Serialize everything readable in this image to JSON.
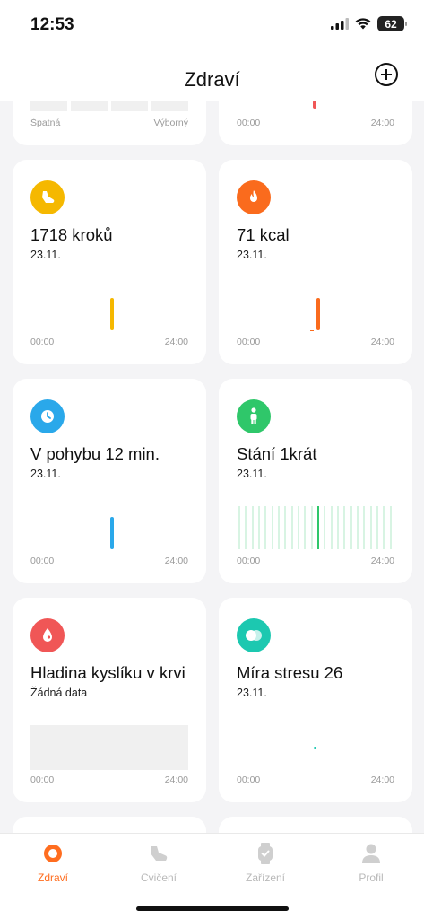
{
  "status": {
    "time": "12:53",
    "battery": "62"
  },
  "header": {
    "title": "Zdraví"
  },
  "top_cards": {
    "left_low_label": "Špatná",
    "left_high_label": "Výborný",
    "right_start": "00:00",
    "right_end": "24:00"
  },
  "cards": {
    "steps": {
      "title": "1718 kroků",
      "date": "23.11.",
      "start": "00:00",
      "end": "24:00",
      "color": "#f5b800"
    },
    "calories": {
      "title": "71 kcal",
      "date": "23.11.",
      "start": "00:00",
      "end": "24:00",
      "color": "#fa6b1d"
    },
    "moving": {
      "title": "V pohybu 12 min.",
      "date": "23.11.",
      "start": "00:00",
      "end": "24:00",
      "color": "#2aa8ea"
    },
    "standing": {
      "title": "Stání 1krát",
      "date": "23.11.",
      "start": "00:00",
      "end": "24:00",
      "color": "#2fc76a"
    },
    "oxygen": {
      "title": "Hladina kyslíku v krvi",
      "date": "Žádná data",
      "start": "00:00",
      "end": "24:00",
      "color": "#f05656"
    },
    "stress": {
      "title": "Míra stresu 26",
      "date": "23.11.",
      "start": "00:00",
      "end": "24:00",
      "color": "#1cc8b0"
    }
  },
  "tabs": [
    {
      "label": "Zdraví",
      "icon": "health-ring-icon",
      "active": true
    },
    {
      "label": "Cvičení",
      "icon": "shoe-icon",
      "active": false
    },
    {
      "label": "Zařízení",
      "icon": "watch-icon",
      "active": false
    },
    {
      "label": "Profil",
      "icon": "person-icon",
      "active": false
    }
  ]
}
